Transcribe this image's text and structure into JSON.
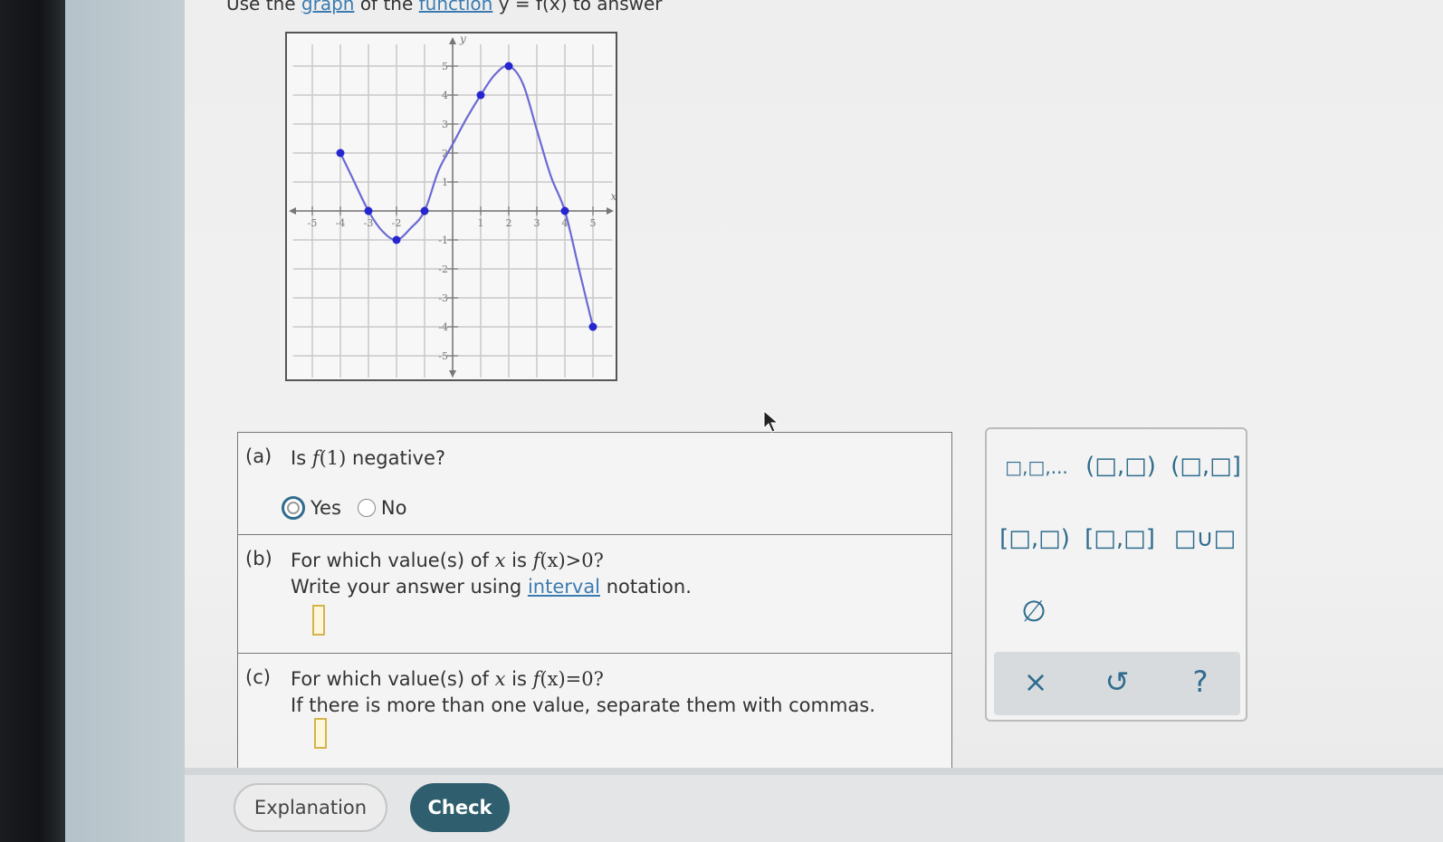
{
  "instruction": {
    "prefix": "Use the",
    "link1": "graph",
    "middle": "of the",
    "link2": "function",
    "suffix": "y = f(x) to answer"
  },
  "chart_data": {
    "type": "line",
    "xlabel": "x",
    "ylabel": "y",
    "xlim": [
      -5.5,
      5.5
    ],
    "ylim": [
      -5.5,
      5.5
    ],
    "grid": true,
    "x_tick_labels": [
      "-5",
      "-4",
      "-3",
      "-2",
      "1",
      "2",
      "3",
      "4",
      "5"
    ],
    "y_tick_labels": [
      "5",
      "4",
      "3",
      "2",
      "1",
      "-1",
      "-2",
      "-3",
      "-4",
      "-5"
    ],
    "curve": [
      [
        -4,
        2
      ],
      [
        -3.6,
        1.2
      ],
      [
        -3,
        0
      ],
      [
        -2.5,
        -0.7
      ],
      [
        -2,
        -1
      ],
      [
        -1.5,
        -0.6
      ],
      [
        -1,
        0
      ],
      [
        -0.5,
        1.4
      ],
      [
        0,
        2.3
      ],
      [
        0.5,
        3.2
      ],
      [
        1,
        4
      ],
      [
        1.5,
        4.7
      ],
      [
        2,
        5
      ],
      [
        2.5,
        4.4
      ],
      [
        3,
        2.8
      ],
      [
        3.5,
        1.2
      ],
      [
        4,
        0
      ],
      [
        4.5,
        -2
      ],
      [
        5,
        -4
      ]
    ],
    "points": [
      [
        -4,
        2
      ],
      [
        -3,
        0
      ],
      [
        -2,
        -1
      ],
      [
        -1,
        0
      ],
      [
        1,
        4
      ],
      [
        2,
        5
      ],
      [
        4,
        0
      ],
      [
        5,
        -4
      ]
    ],
    "color": "#6a6ad4",
    "point_color": "#2626d0"
  },
  "part_a": {
    "letter": "(a)",
    "q_prefix": "Is",
    "f": "f",
    "arg": "(1)",
    "q_suffix": "negative?",
    "yes": "Yes",
    "no": "No"
  },
  "part_b": {
    "letter": "(b)",
    "q_prefix": "For which value(s) of",
    "x": "x",
    "is": "is",
    "f": "f",
    "expr": "(x)>0?",
    "line2_prefix": "Write your answer using",
    "line2_link": "interval",
    "line2_suffix": "notation."
  },
  "part_c": {
    "letter": "(c)",
    "q_prefix": "For which value(s) of",
    "x": "x",
    "is": "is",
    "f": "f",
    "expr": "(x)=0?",
    "line2": "If there is more than one value, separate them with commas."
  },
  "keypad": {
    "list": "□,□,...",
    "open_open": "(□,□)",
    "open_closed": "(□,□]",
    "closed_open": "[□,□)",
    "closed_closed": "[□,□]",
    "union": "□∪□",
    "empty_set": "∅",
    "clear": "×",
    "undo": "↺",
    "help": "?"
  },
  "buttons": {
    "explanation": "Explanation",
    "check": "Check"
  }
}
